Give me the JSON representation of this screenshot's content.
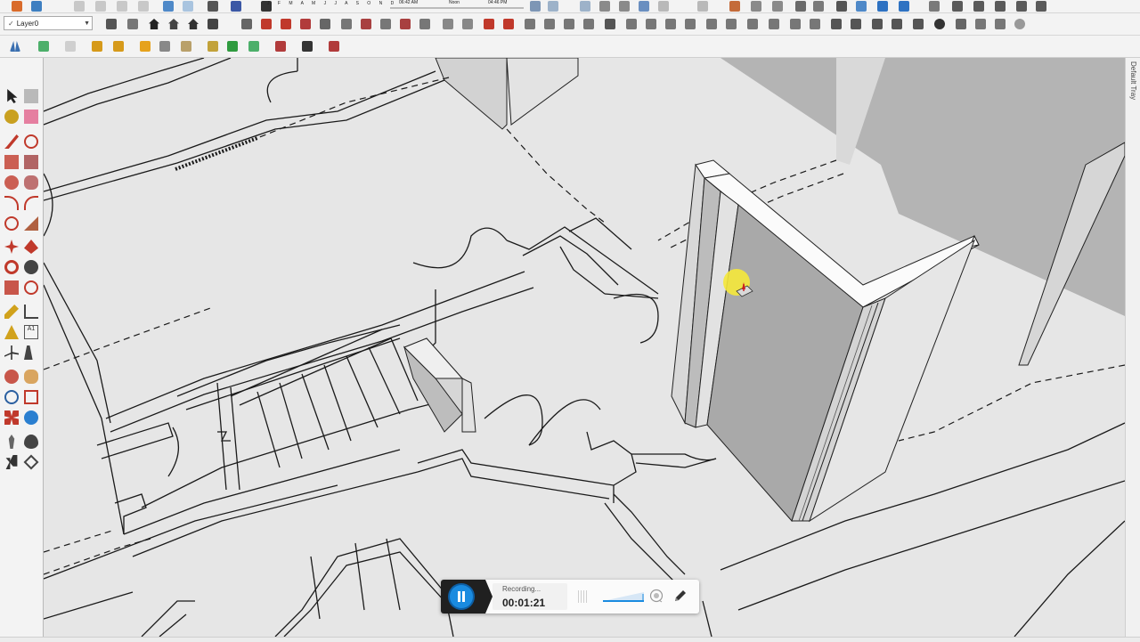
{
  "layers": {
    "current": "Layer0",
    "check": "✓",
    "arrow": "▼"
  },
  "shadow_bar": {
    "months": "J F M A M J J A S O N D",
    "time_left": "06:42 AM",
    "time_mid": "Noon",
    "time_right": "04:46 PM"
  },
  "tray": {
    "title": "Default Tray"
  },
  "recorder": {
    "status": "Recording...",
    "elapsed": "00:01:21"
  },
  "icons": {
    "select": "select-arrow-icon",
    "make_component": "make-component-icon",
    "paint_bucket": "paint-bucket-icon",
    "eraser": "eraser-icon",
    "line": "pencil-line-icon",
    "freehand": "freehand-icon",
    "rectangle": "rectangle-icon",
    "rotated_rectangle": "rotated-rectangle-icon",
    "circle": "circle-icon",
    "polygon": "polygon-icon",
    "arc": "arc-icon",
    "pie": "pie-icon",
    "move": "move-icon",
    "push_pull": "push-pull-icon",
    "rotate": "rotate-icon",
    "follow_me": "follow-me-icon",
    "scale": "scale-icon",
    "offset": "offset-icon",
    "tape_measure": "tape-measure-icon",
    "dimension": "dimension-icon",
    "protractor": "protractor-icon",
    "text": "text-icon",
    "axes": "axes-icon",
    "3d_text": "3d-text-icon",
    "orbit": "orbit-icon",
    "pan": "pan-icon",
    "zoom": "zoom-icon",
    "zoom_window": "zoom-window-icon",
    "zoom_extents": "zoom-extents-icon",
    "previous_view": "previous-view-icon",
    "position_camera": "position-camera-icon",
    "look_around": "look-around-icon",
    "walk": "walk-icon",
    "section_plane": "section-plane-icon"
  },
  "colors": {
    "accent_blue": "#1a8be0",
    "cursor_highlight": "#f5e83a",
    "push_pull_red": "#cc1e1e",
    "viewport_bg": "#e6e6e6",
    "wall_shade": "#a9a9a9"
  }
}
